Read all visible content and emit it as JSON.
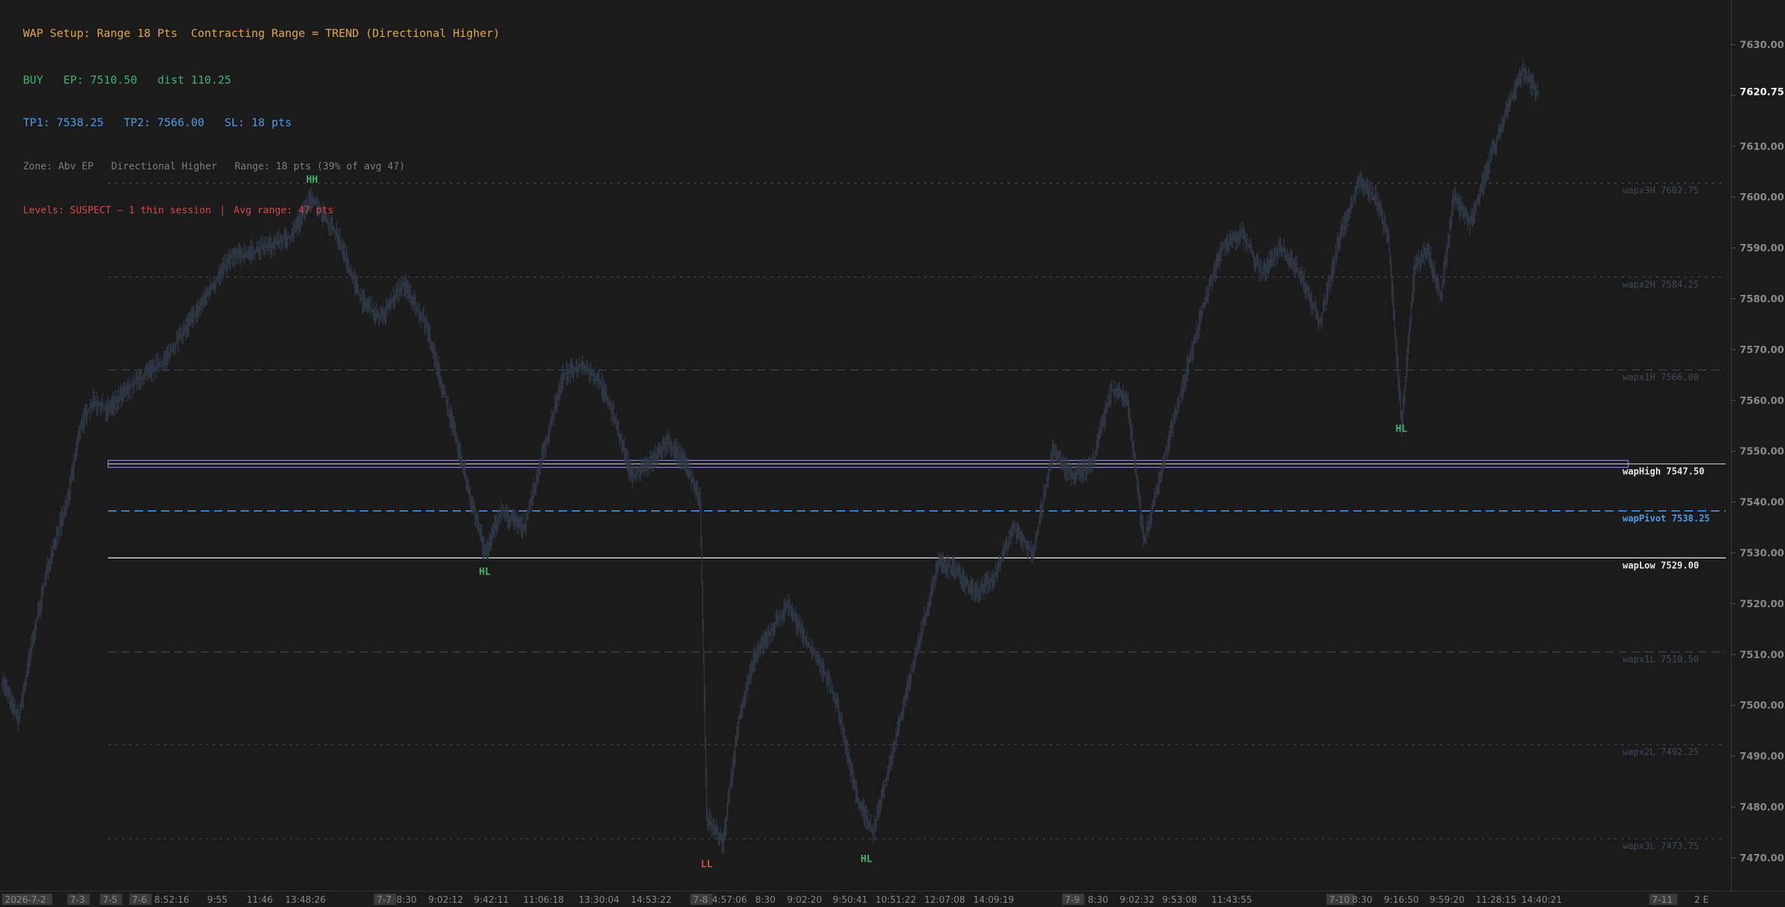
{
  "hud": {
    "setup_line": "WAP Setup: Range 18 Pts  Contracting Range = TREND (Directional Higher)",
    "signal": "BUY",
    "entry": "EP: 7510.50",
    "distance": "dist 110.25",
    "tp1": "TP1: 7538.25",
    "tp2": "TP2: 7566.00",
    "sl": "SL: 18 pts",
    "zone": "Zone: Abv EP",
    "direction": "Directional Higher",
    "range_info": "Range: 18 pts (39% of avg 47)",
    "levels_status": "Levels: SUSPECT — 1 thin session",
    "levels_sep": "|",
    "avg_range": "Avg range: 47 pts"
  },
  "colors": {
    "background": "#1b1b1b",
    "candles": "#303a48",
    "setup_text": "#e2a64a",
    "buy": "#3fb36d",
    "targets": "#4d9be6",
    "muted": "#7a7f86",
    "warning": "#d84646",
    "level_dim": "#3e4a5c",
    "level_band": "#8f86d8",
    "wap_low": "#e6e6e6"
  },
  "chart_data": {
    "type": "line",
    "ylim": [
      7465,
      7635
    ],
    "y_ticks": [
      "7630.00",
      "7620.00",
      "7610.00",
      "7600.00",
      "7590.00",
      "7580.00",
      "7570.00",
      "7560.00",
      "7550.00",
      "7540.00",
      "7530.00",
      "7520.00",
      "7510.00",
      "7500.00",
      "7490.00",
      "7480.00",
      "7470.00"
    ],
    "last_price": 7620.75,
    "last_price_label": "7620.75",
    "x_labels": [
      {
        "label": "2026-7-2",
        "idx": 0,
        "boxed": true
      },
      {
        "label": "7-3",
        "idx": 20,
        "boxed": true
      },
      {
        "label": "7-5",
        "idx": 30,
        "boxed": true
      },
      {
        "label": "7-6",
        "idx": 39,
        "boxed": true
      },
      {
        "label": "8:52:16",
        "idx": 52,
        "boxed": false
      },
      {
        "label": "9:55",
        "idx": 66,
        "boxed": false
      },
      {
        "label": "11:46",
        "idx": 79,
        "boxed": false
      },
      {
        "label": "13:48:26",
        "idx": 93,
        "boxed": false
      },
      {
        "label": "7-7",
        "idx": 114,
        "boxed": true
      },
      {
        "label": "8:30",
        "idx": 124,
        "boxed": false
      },
      {
        "label": "9:02:12",
        "idx": 136,
        "boxed": false
      },
      {
        "label": "9:42:11",
        "idx": 150,
        "boxed": false
      },
      {
        "label": "11:06:18",
        "idx": 166,
        "boxed": false
      },
      {
        "label": "13:30:04",
        "idx": 183,
        "boxed": false
      },
      {
        "label": "14:53:22",
        "idx": 199,
        "boxed": false
      },
      {
        "label": "7-8",
        "idx": 211,
        "boxed": true
      },
      {
        "label": "4:57:06",
        "idx": 223,
        "boxed": false
      },
      {
        "label": "8:30",
        "idx": 234,
        "boxed": false
      },
      {
        "label": "9:02:20",
        "idx": 246,
        "boxed": false
      },
      {
        "label": "9:50:41",
        "idx": 260,
        "boxed": false
      },
      {
        "label": "10:51:22",
        "idx": 274,
        "boxed": false
      },
      {
        "label": "12:07:08",
        "idx": 289,
        "boxed": false
      },
      {
        "label": "14:09:19",
        "idx": 304,
        "boxed": false
      },
      {
        "label": "7-9",
        "idx": 325,
        "boxed": true
      },
      {
        "label": "8:30",
        "idx": 336,
        "boxed": false
      },
      {
        "label": "9:02:32",
        "idx": 348,
        "boxed": false
      },
      {
        "label": "9:53:08",
        "idx": 361,
        "boxed": false
      },
      {
        "label": "11:43:55",
        "idx": 377,
        "boxed": false
      },
      {
        "label": "7-10",
        "idx": 406,
        "boxed": true
      },
      {
        "label": "8:30",
        "idx": 417,
        "boxed": false
      },
      {
        "label": "9:16:50",
        "idx": 429,
        "boxed": false
      },
      {
        "label": "9:59:20",
        "idx": 443,
        "boxed": false
      },
      {
        "label": "11:28:15",
        "idx": 458,
        "boxed": false
      },
      {
        "label": "14:40:21",
        "idx": 472,
        "boxed": false
      },
      {
        "label": "7-11",
        "idx": 505,
        "boxed": true
      },
      {
        "label": "2 E",
        "idx": 521,
        "boxed": false
      }
    ],
    "levels": [
      {
        "name": "wapx3H",
        "price": 7602.75,
        "label": "wapx3H 7602.75",
        "style": "dotted",
        "kind": "dim"
      },
      {
        "name": "wapx2H",
        "price": 7584.25,
        "label": "wapx2H 7584.25",
        "style": "dotted",
        "kind": "dim"
      },
      {
        "name": "wapx1H",
        "price": 7566.0,
        "label": "wapx1H 7566.00",
        "style": "dashed",
        "kind": "dim"
      },
      {
        "name": "wapHigh",
        "price": 7547.5,
        "label": "wapHigh 7547.50",
        "style": "band",
        "kind": "band"
      },
      {
        "name": "wapPivot",
        "price": 7538.25,
        "label": "wapPivot 7538.25",
        "style": "dashed",
        "kind": "pivot"
      },
      {
        "name": "wapLow",
        "price": 7529.0,
        "label": "wapLow 7529.00",
        "style": "solid",
        "kind": "low"
      },
      {
        "name": "wapx1L",
        "price": 7510.5,
        "label": "wapx1L 7510.50",
        "style": "dashed",
        "kind": "dim"
      },
      {
        "name": "wapx2L",
        "price": 7492.25,
        "label": "wapx2L 7492.25",
        "style": "dotted",
        "kind": "dim"
      },
      {
        "name": "wapx3L",
        "price": 7473.75,
        "label": "wapx3L 7473.75",
        "style": "dotted",
        "kind": "dim"
      }
    ],
    "swing_labels": [
      {
        "label": "HH",
        "idx": 95,
        "price": 7602.0,
        "kind": "high",
        "color": "#3fb36d"
      },
      {
        "label": "HL",
        "idx": 148,
        "price": 7528.0,
        "kind": "low",
        "color": "#3fb36d"
      },
      {
        "label": "LL",
        "idx": 216,
        "price": 7470.5,
        "kind": "low",
        "color": "#d84646"
      },
      {
        "label": "HL",
        "idx": 265,
        "price": 7471.5,
        "kind": "low",
        "color": "#3fb36d"
      },
      {
        "label": "HL",
        "idx": 429,
        "price": 7553.0,
        "kind": "high",
        "color": "#3fb36d"
      }
    ],
    "price_anchors": [
      [
        0,
        7505
      ],
      [
        5,
        7497
      ],
      [
        10,
        7515
      ],
      [
        15,
        7530
      ],
      [
        20,
        7540
      ],
      [
        24,
        7555
      ],
      [
        28,
        7560
      ],
      [
        32,
        7558
      ],
      [
        40,
        7563
      ],
      [
        50,
        7568
      ],
      [
        60,
        7578
      ],
      [
        70,
        7588
      ],
      [
        80,
        7590
      ],
      [
        88,
        7592
      ],
      [
        95,
        7600
      ],
      [
        103,
        7592
      ],
      [
        110,
        7580
      ],
      [
        116,
        7576
      ],
      [
        123,
        7583
      ],
      [
        130,
        7575
      ],
      [
        136,
        7560
      ],
      [
        142,
        7545
      ],
      [
        148,
        7530
      ],
      [
        153,
        7538
      ],
      [
        160,
        7535
      ],
      [
        166,
        7550
      ],
      [
        172,
        7565
      ],
      [
        178,
        7567
      ],
      [
        183,
        7564
      ],
      [
        188,
        7556
      ],
      [
        193,
        7545
      ],
      [
        199,
        7548
      ],
      [
        204,
        7552
      ],
      [
        209,
        7548
      ],
      [
        214,
        7540
      ],
      [
        216,
        7478
      ],
      [
        221,
        7473
      ],
      [
        226,
        7498
      ],
      [
        231,
        7510
      ],
      [
        236,
        7515
      ],
      [
        241,
        7520
      ],
      [
        246,
        7513
      ],
      [
        251,
        7508
      ],
      [
        256,
        7500
      ],
      [
        262,
        7482
      ],
      [
        267,
        7475
      ],
      [
        272,
        7488
      ],
      [
        277,
        7502
      ],
      [
        282,
        7515
      ],
      [
        287,
        7528
      ],
      [
        292,
        7527
      ],
      [
        298,
        7522
      ],
      [
        304,
        7525
      ],
      [
        310,
        7535
      ],
      [
        316,
        7530
      ],
      [
        322,
        7550
      ],
      [
        328,
        7545
      ],
      [
        334,
        7547
      ],
      [
        340,
        7562
      ],
      [
        345,
        7560
      ],
      [
        350,
        7532
      ],
      [
        356,
        7548
      ],
      [
        362,
        7563
      ],
      [
        368,
        7578
      ],
      [
        374,
        7590
      ],
      [
        380,
        7593
      ],
      [
        386,
        7585
      ],
      [
        392,
        7590
      ],
      [
        398,
        7585
      ],
      [
        404,
        7575
      ],
      [
        410,
        7592
      ],
      [
        416,
        7603
      ],
      [
        421,
        7600
      ],
      [
        425,
        7592
      ],
      [
        429,
        7555
      ],
      [
        433,
        7586
      ],
      [
        437,
        7590
      ],
      [
        441,
        7580
      ],
      [
        445,
        7600
      ],
      [
        450,
        7595
      ],
      [
        455,
        7605
      ],
      [
        460,
        7615
      ],
      [
        466,
        7625
      ],
      [
        471,
        7620
      ]
    ]
  }
}
